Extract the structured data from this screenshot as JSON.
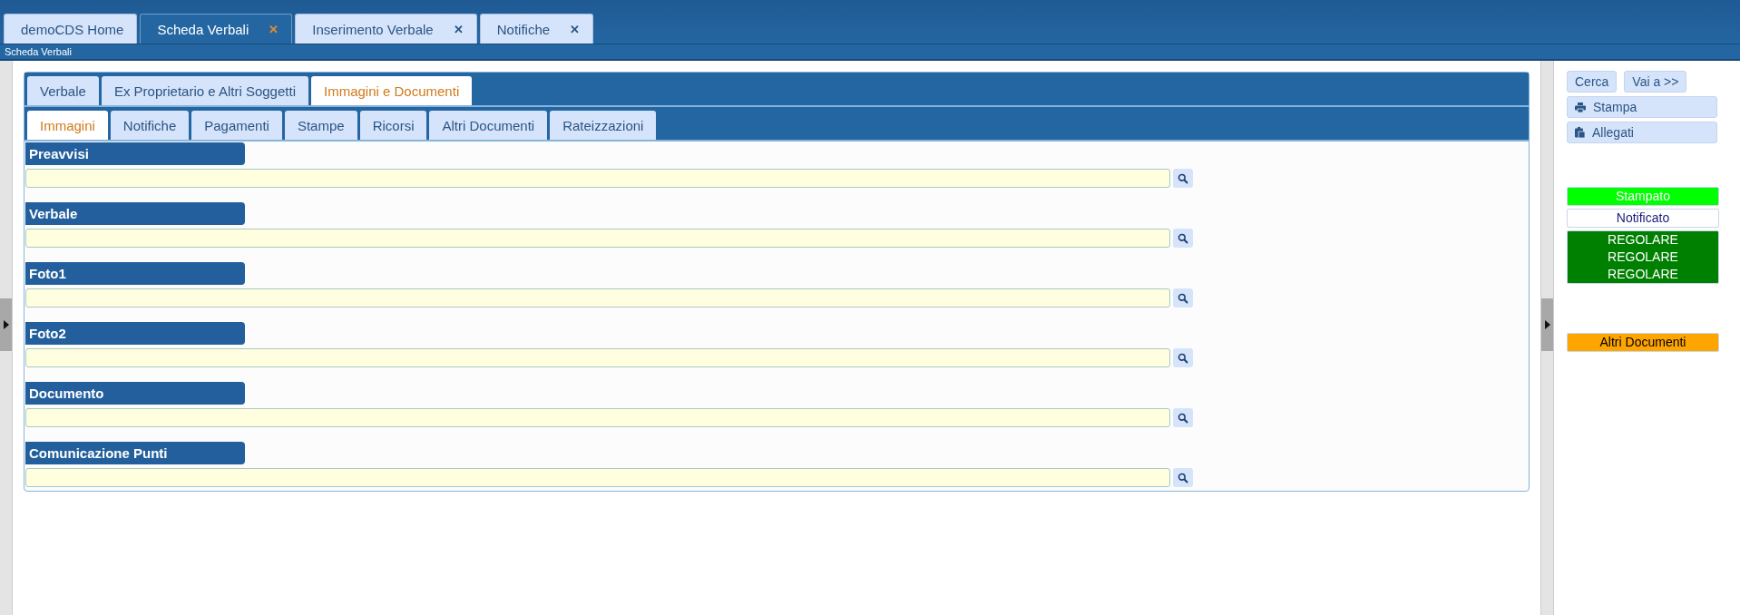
{
  "window_tabs": [
    {
      "label": "demoCDS Home",
      "selected": false,
      "closable": false
    },
    {
      "label": "Scheda Verbali",
      "selected": true,
      "closable": true
    },
    {
      "label": "Inserimento Verbale",
      "selected": false,
      "closable": true
    },
    {
      "label": "Notifiche",
      "selected": false,
      "closable": true
    }
  ],
  "close_glyph": "✕",
  "page_title": "Scheda Verbali",
  "main_tabs": [
    {
      "label": "Verbale",
      "selected": false
    },
    {
      "label": "Ex Proprietario e Altri Soggetti",
      "selected": false
    },
    {
      "label": "Immagini e Documenti",
      "selected": true
    }
  ],
  "sub_tabs": [
    {
      "label": "Immagini",
      "selected": true
    },
    {
      "label": "Notifiche",
      "selected": false
    },
    {
      "label": "Pagamenti",
      "selected": false
    },
    {
      "label": "Stampe",
      "selected": false
    },
    {
      "label": "Ricorsi",
      "selected": false
    },
    {
      "label": "Altri Documenti",
      "selected": false
    },
    {
      "label": "Rateizzazioni",
      "selected": false
    }
  ],
  "sections": [
    {
      "label": "Preavvisi"
    },
    {
      "label": "Verbale"
    },
    {
      "label": "Foto1"
    },
    {
      "label": "Foto2"
    },
    {
      "label": "Documento"
    },
    {
      "label": "Comunicazione Punti"
    }
  ],
  "side_buttons": {
    "row": [
      {
        "label": "Cerca"
      },
      {
        "label": "Vai a >>"
      }
    ],
    "wide": [
      {
        "label": "Stampa",
        "kind": "print"
      },
      {
        "label": "Allegati",
        "kind": "attachments"
      }
    ]
  },
  "status_badges": [
    {
      "lines": [
        "Stampato"
      ],
      "color": "#00ff00"
    },
    {
      "lines": [
        "Notificato"
      ],
      "color": "#ffffff"
    },
    {
      "lines": [
        "REGOLARE",
        "REGOLARE",
        "REGOLARE"
      ],
      "color": "#008000"
    }
  ],
  "extra_badge": {
    "lines": [
      "Altri Documenti"
    ],
    "color": "#ffa500"
  }
}
